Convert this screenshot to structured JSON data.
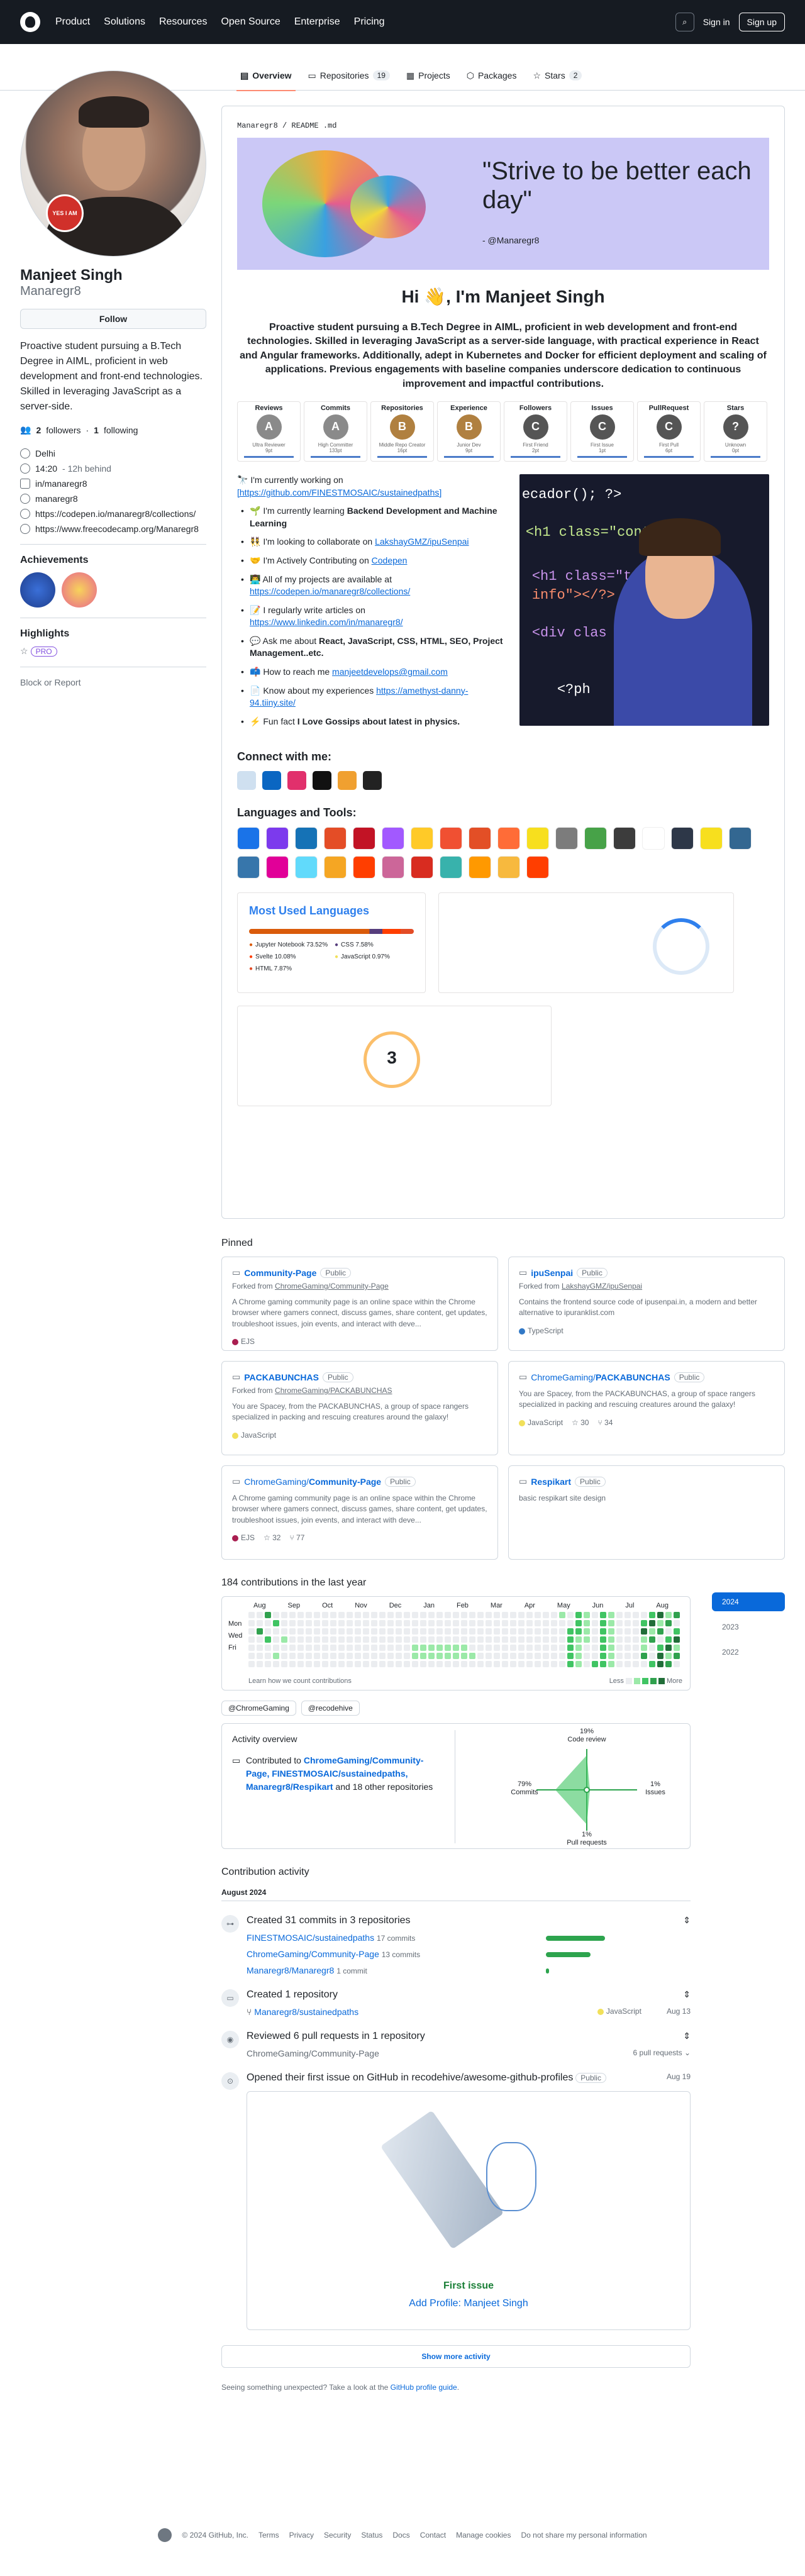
{
  "nav": {
    "items": [
      "Product",
      "Solutions",
      "Resources",
      "Open Source",
      "Enterprise",
      "Pricing"
    ],
    "sign_in": "Sign in",
    "sign_up": "Sign up"
  },
  "tabs": [
    {
      "label": "Overview",
      "count": ""
    },
    {
      "label": "Repositories",
      "count": "19"
    },
    {
      "label": "Projects",
      "count": ""
    },
    {
      "label": "Packages",
      "count": ""
    },
    {
      "label": "Stars",
      "count": "2"
    }
  ],
  "profile": {
    "avatar_badge": "YES I AM",
    "name": "Manjeet Singh",
    "username": "Manaregr8",
    "follow": "Follow",
    "bio": "Proactive student pursuing a B.Tech Degree in AIML, proficient in web development and front-end technologies. Skilled in leveraging JavaScript as a server-side.",
    "followers": "2",
    "followers_label": "followers",
    "following": "1",
    "following_label": "following",
    "location": "Delhi",
    "time": "14:20",
    "time_note": "- 12h behind",
    "linkedin": "in/manaregr8",
    "handle": "manaregr8",
    "link1": "https://codepen.io/manaregr8/collections/",
    "link2": "https://www.freecodecamp.org/Manaregr8",
    "achievements_title": "Achievements",
    "highlights_title": "Highlights",
    "pro": "PRO",
    "block": "Block or Report"
  },
  "readme": {
    "path": "Manaregr8 / README .md",
    "quote": "\"Strive to be better each day\"",
    "quote_by": "- @Manaregr8",
    "hi": "Hi 👋, I'm Manjeet Singh",
    "bio": "Proactive student pursuing a B.Tech Degree in AIML, proficient in web development and front-end technologies. Skilled in leveraging JavaScript as a server-side language, with practical experience in React and Angular frameworks. Additionally, adept in Kubernetes and Docker for efficient deployment and scaling of applications. Previous engagements with baseline companies underscore dedication to continuous improvement and impactful contributions.",
    "trophies": [
      {
        "title": "Reviews",
        "rank": "A",
        "name": "Ultra Reviewer",
        "stat": "9pt",
        "color": "#8a8a8a"
      },
      {
        "title": "Commits",
        "rank": "A",
        "name": "High Committer",
        "stat": "133pt",
        "color": "#8a8a8a"
      },
      {
        "title": "Repositories",
        "rank": "B",
        "name": "Middle Repo Creator",
        "stat": "16pt",
        "color": "#b08040"
      },
      {
        "title": "Experience",
        "rank": "B",
        "name": "Junior Dev",
        "stat": "9pt",
        "color": "#b08040"
      },
      {
        "title": "Followers",
        "rank": "C",
        "name": "First Friend",
        "stat": "2pt",
        "color": "#555"
      },
      {
        "title": "Issues",
        "rank": "C",
        "name": "First Issue",
        "stat": "1pt",
        "color": "#555"
      },
      {
        "title": "PullRequest",
        "rank": "C",
        "name": "First Pull",
        "stat": "6pt",
        "color": "#555"
      },
      {
        "title": "Stars",
        "rank": "?",
        "name": "Unknown",
        "stat": "0pt",
        "color": "#555"
      }
    ],
    "working_on": "🔭 I'm currently working on",
    "working_link": "[https://github.com/FINESTMOSAIC/sustainedpaths]",
    "bullets": [
      {
        "pre": "🌱 I'm currently learning ",
        "bold": "Backend Development and Machine Learning",
        "link": ""
      },
      {
        "pre": "👯 I'm looking to collaborate on ",
        "bold": "",
        "link": "LakshayGMZ/ipuSenpai"
      },
      {
        "pre": "🤝 I'm Actively Contributing on ",
        "bold": "",
        "link": "Codepen"
      },
      {
        "pre": "👨‍💻 All of my projects are available at ",
        "bold": "",
        "link": "https://codepen.io/manaregr8/collections/"
      },
      {
        "pre": "📝 I regularly write articles on ",
        "bold": "",
        "link": "https://www.linkedin.com/in/manaregr8/"
      },
      {
        "pre": "💬 Ask me about ",
        "bold": "React, JavaScript, CSS, HTML, SEO, Project Management..etc.",
        "link": ""
      },
      {
        "pre": "📫 How to reach me ",
        "bold": "",
        "link": "manjeetdevelops@gmail.com"
      },
      {
        "pre": "📄 Know about my experiences ",
        "bold": "",
        "link": "https://amethyst-danny-94.tiiny.site/"
      },
      {
        "pre": "⚡ Fun fact ",
        "bold": "I Love Gossips about latest in physics.",
        "link": ""
      }
    ],
    "code_lines": [
      "ecador(); ?>",
      "<h1 class=\"container\">",
      "<h1 class=\"te",
      "info\"></?>",
      "<div clas",
      "<?ph"
    ],
    "connect": "Connect with me:",
    "tools": "Languages and Tools:",
    "lang_title": "Most Used Languages",
    "langs": [
      {
        "name": "Jupyter Notebook 73.52%",
        "color": "#da5b0b"
      },
      {
        "name": "CSS 7.58%",
        "color": "#563d7c"
      },
      {
        "name": "Svelte 10.08%",
        "color": "#ff3e00"
      },
      {
        "name": "JavaScript 0.97%",
        "color": "#f1e05a"
      },
      {
        "name": "HTML 7.87%",
        "color": "#e34c26"
      }
    ],
    "streak": "3"
  },
  "pinned": {
    "title": "Pinned",
    "items": [
      {
        "name": "Community-Page",
        "owner": "",
        "vis": "Public",
        "fork": "ChromeGaming/Community-Page",
        "forked_label": "Forked from",
        "desc": "A Chrome gaming community page is an online space within the Chrome browser where gamers connect, discuss games, share content, get updates, troubleshoot issues, join events, and interact with deve...",
        "lang": "EJS",
        "lang_color": "#a91e50",
        "stars": "",
        "forks": ""
      },
      {
        "name": "ipuSenpai",
        "owner": "",
        "vis": "Public",
        "fork": "LakshayGMZ/ipuSenpai",
        "forked_label": "Forked from",
        "desc": "Contains the frontend source code of ipusenpai.in, a modern and better alternative to ipuranklist.com",
        "lang": "TypeScript",
        "lang_color": "#3178c6",
        "stars": "",
        "forks": ""
      },
      {
        "name": "PACKABUNCHAS",
        "owner": "",
        "vis": "Public",
        "fork": "ChromeGaming/PACKABUNCHAS",
        "forked_label": "Forked from",
        "desc": "You are Spacey, from the PACKABUNCHAS, a group of space rangers specialized in packing and rescuing creatures around the galaxy!",
        "lang": "JavaScript",
        "lang_color": "#f1e05a",
        "stars": "",
        "forks": ""
      },
      {
        "name": "PACKABUNCHAS",
        "owner": "ChromeGaming/",
        "vis": "Public",
        "fork": "",
        "forked_label": "",
        "desc": "You are Spacey, from the PACKABUNCHAS, a group of space rangers specialized in packing and rescuing creatures around the galaxy!",
        "lang": "JavaScript",
        "lang_color": "#f1e05a",
        "stars": "30",
        "forks": "34"
      },
      {
        "name": "Community-Page",
        "owner": "ChromeGaming/",
        "vis": "Public",
        "fork": "",
        "forked_label": "",
        "desc": "A Chrome gaming community page is an online space within the Chrome browser where gamers connect, discuss games, share content, get updates, troubleshoot issues, join events, and interact with deve...",
        "lang": "EJS",
        "lang_color": "#a91e50",
        "stars": "32",
        "forks": "77"
      },
      {
        "name": "Respikart",
        "owner": "",
        "vis": "Public",
        "fork": "",
        "forked_label": "",
        "desc": "basic respikart site design",
        "lang": "",
        "lang_color": "",
        "stars": "",
        "forks": ""
      }
    ]
  },
  "contrib": {
    "title": "184 contributions in the last year",
    "months": [
      "Aug",
      "Sep",
      "Oct",
      "Nov",
      "Dec",
      "Jan",
      "Feb",
      "Mar",
      "Apr",
      "May",
      "Jun",
      "Jul",
      "Aug"
    ],
    "days": [
      "Mon",
      "Wed",
      "Fri"
    ],
    "learn": "Learn how we count contributions",
    "less": "Less",
    "more": "More",
    "years": [
      "2024",
      "2023",
      "2022"
    ],
    "orgs": [
      "@ChromeGaming",
      "@recodehive"
    ],
    "overview_title": "Activity overview",
    "contributed_pre": "Contributed to",
    "contributed_links": "ChromeGaming/Community-Page, FINESTMOSAIC/sustainedpaths, Manaregr8/Respikart",
    "contributed_post": "and 18 other repositories",
    "axes": {
      "code_review": "19%",
      "code_review_label": "Code review",
      "commits": "79%",
      "commits_label": "Commits",
      "issues": "1%",
      "issues_label": "Issues",
      "prs": "1%",
      "prs_label": "Pull requests"
    }
  },
  "activity": {
    "title": "Contribution activity",
    "month": "August 2024",
    "commits_title": "Created 31 commits in 3 repositories",
    "commit_repos": [
      {
        "name": "FINESTMOSAIC/sustainedpaths",
        "n": "17 commits",
        "frac": 0.55
      },
      {
        "name": "ChromeGaming/Community-Page",
        "n": "13 commits",
        "frac": 0.42
      },
      {
        "name": "Manaregr8/Manaregr8",
        "n": "1 commit",
        "frac": 0.03
      }
    ],
    "repo_title": "Created 1 repository",
    "repo_name": "Manaregr8/sustainedpaths",
    "repo_lang": "JavaScript",
    "repo_date": "Aug 13",
    "reviewed_title": "Reviewed 6 pull requests in 1 repository",
    "reviewed_repo": "ChromeGaming/Community-Page",
    "reviewed_count": "6 pull requests",
    "issue_title": "Opened their first issue on GitHub in recodehive/awesome-github-profiles",
    "issue_vis": "Public",
    "issue_date": "Aug 19",
    "first_issue": "First issue",
    "issue_name": "Add Profile: Manjeet Singh",
    "show_more": "Show more activity",
    "unexpected": "Seeing something unexpected? Take a look at the ",
    "guide": "GitHub profile guide",
    "guide_end": "."
  },
  "footer": [
    "© 2024 GitHub, Inc.",
    "Terms",
    "Privacy",
    "Security",
    "Status",
    "Docs",
    "Contact",
    "Manage cookies",
    "Do not share my personal information"
  ]
}
